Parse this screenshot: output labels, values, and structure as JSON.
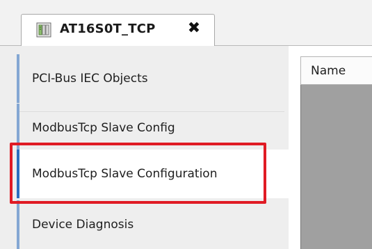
{
  "tab": {
    "title": "AT16S0T_TCP",
    "icon": "device-icon",
    "close_glyph": "✖"
  },
  "sidebar": {
    "items": [
      {
        "label": "PCI-Bus IEC Objects",
        "selected": false
      },
      {
        "label": "ModbusTcp Slave Config",
        "selected": false
      },
      {
        "label": "ModbusTcp Slave Configuration",
        "selected": true
      },
      {
        "label": "Device Diagnosis",
        "selected": false
      }
    ]
  },
  "table": {
    "columns": [
      "Name"
    ]
  },
  "colors": {
    "highlight": "#e01b24",
    "selected_accent": "#2c6fbf",
    "accent": "#84a7d3"
  }
}
